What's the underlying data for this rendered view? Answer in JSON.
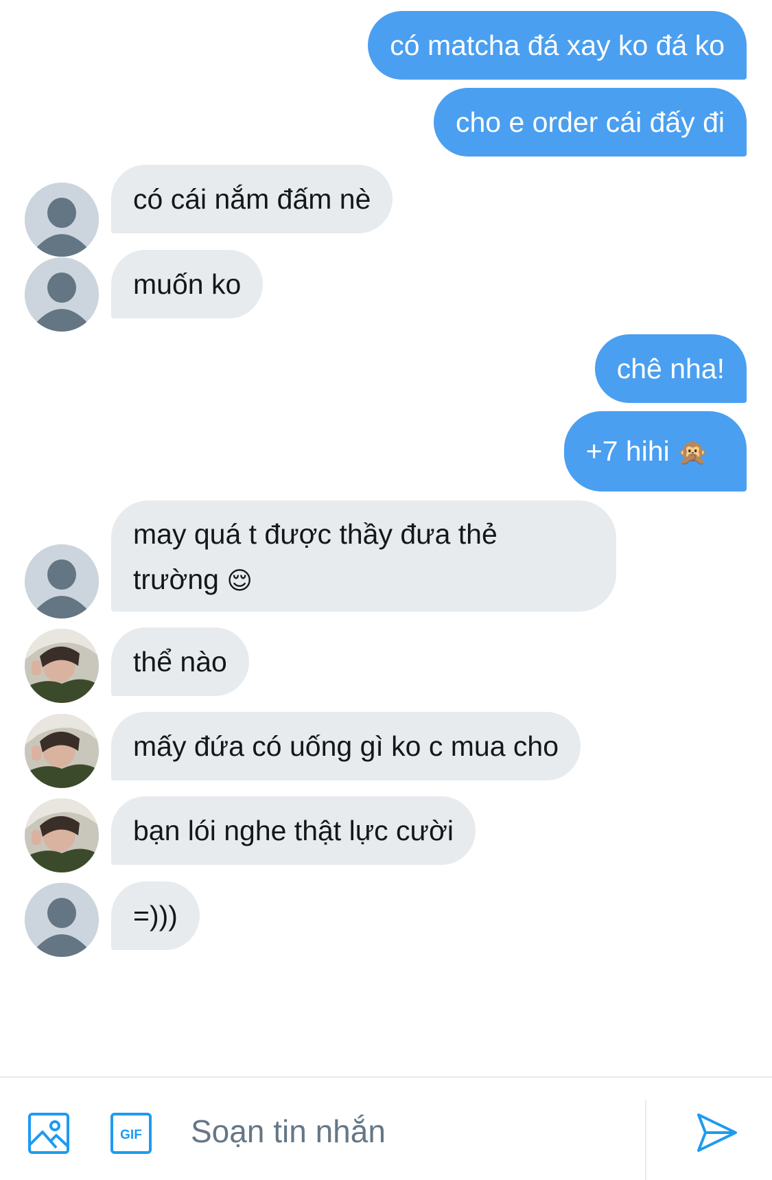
{
  "thread": {
    "messages": [
      {
        "direction": "outgoing",
        "text": "có matcha đá xay ko đá ko"
      },
      {
        "direction": "outgoing",
        "text": "cho e order cái đấy đi"
      },
      {
        "direction": "incoming",
        "sender_avatar": "default-profile",
        "text": "có cái nắm đấm nè"
      },
      {
        "direction": "incoming",
        "sender_avatar": "default-profile",
        "text": "muốn ko"
      },
      {
        "direction": "outgoing",
        "text": "chê nha!"
      },
      {
        "direction": "outgoing",
        "text": "+7 hihi",
        "emoji": "🙊"
      },
      {
        "direction": "incoming",
        "sender_avatar": "default-profile",
        "text_line1": "may quá t được thầy đưa thẻ",
        "text_line2": "trường",
        "emoji": "😌"
      },
      {
        "direction": "incoming",
        "sender_avatar": "photo-profile",
        "text": "thể nào"
      },
      {
        "direction": "incoming",
        "sender_avatar": "photo-profile",
        "text": "mấy đứa có uống gì ko c mua cho"
      },
      {
        "direction": "incoming",
        "sender_avatar": "photo-profile",
        "text": "bạn lói nghe thật lực cười"
      },
      {
        "direction": "incoming",
        "sender_avatar": "default-profile",
        "text": "=)))"
      }
    ]
  },
  "composer": {
    "placeholder": "Soạn tin nhắn",
    "media_icon": "image-icon",
    "gif_label": "GIF",
    "send_icon": "send-icon"
  },
  "colors": {
    "outgoing_bubble": "#4a9ff0",
    "incoming_bubble": "#e7ebee",
    "accent": "#1d9bf0"
  }
}
